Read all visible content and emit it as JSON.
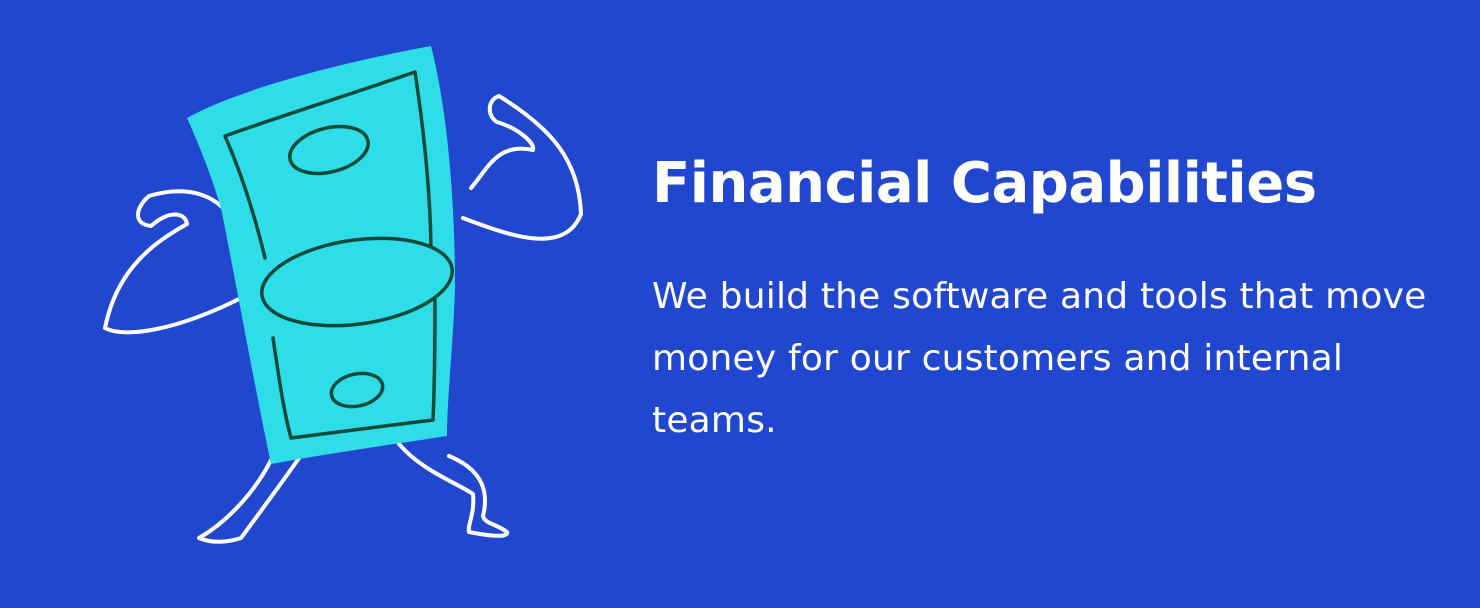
{
  "section": {
    "title": "Financial Capabilities",
    "description": "We build the software and tools that move money for our customers and internal teams."
  },
  "illustration": {
    "icon": "flexing-dollar-bill-icon"
  },
  "colors": {
    "background": "#2247CF",
    "bill_fill": "#2FDDE8",
    "bill_outline": "#0E4A3A",
    "limb_stroke": "#FFFFFF",
    "text": "#FFFFFF"
  }
}
